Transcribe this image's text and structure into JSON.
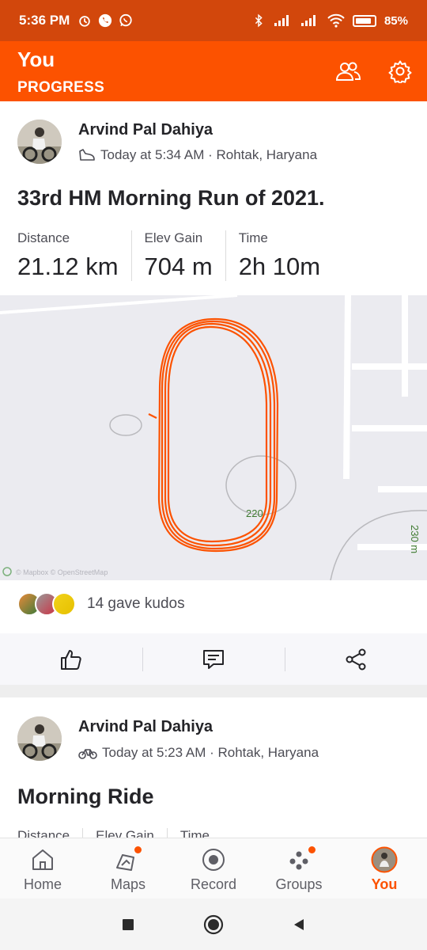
{
  "status_bar": {
    "time": "5:36 PM",
    "battery_text": "85%",
    "battery_level": 0.85
  },
  "app_bar": {
    "title": "You",
    "subtitle": "PROGRESS",
    "icons": [
      "people-icon",
      "gear-icon"
    ]
  },
  "feed": {
    "activities": [
      {
        "athlete": "Arvind Pal Dahiya",
        "type_icon": "run-shoe-icon",
        "meta": "Today at 5:34 AM · Rohtak, Haryana",
        "title": "33rd HM Morning Run of 2021.",
        "stats": [
          {
            "label": "Distance",
            "value": "21.12 km"
          },
          {
            "label": "Elev Gain",
            "value": "704 m"
          },
          {
            "label": "Time",
            "value": "2h 10m"
          }
        ],
        "map": {
          "contour_labels": [
            "220",
            "230 m"
          ],
          "attribution": "© Mapbox © OpenStreetMap",
          "route_color": "#fc5200"
        },
        "kudos_text": "14 gave kudos",
        "actions": [
          "thumbs-up-icon",
          "comment-icon",
          "share-icon"
        ]
      },
      {
        "athlete": "Arvind Pal Dahiya",
        "type_icon": "bike-icon",
        "meta": "Today at 5:23 AM · Rohtak, Haryana",
        "title": "Morning Ride",
        "stats": [
          {
            "label": "Distance"
          },
          {
            "label": "Elev Gain"
          },
          {
            "label": "Time"
          }
        ]
      }
    ]
  },
  "tab_bar": {
    "tabs": [
      {
        "label": "Home",
        "icon": "home-icon"
      },
      {
        "label": "Maps",
        "icon": "map-icon",
        "badge": true
      },
      {
        "label": "Record",
        "icon": "record-icon"
      },
      {
        "label": "Groups",
        "icon": "groups-icon",
        "badge": true
      },
      {
        "label": "You",
        "icon": "avatar",
        "active": true
      }
    ]
  },
  "colors": {
    "status_bar": "#d2470c",
    "accent": "#fc5200",
    "text_primary": "#242428",
    "text_secondary": "#4d4d55"
  }
}
